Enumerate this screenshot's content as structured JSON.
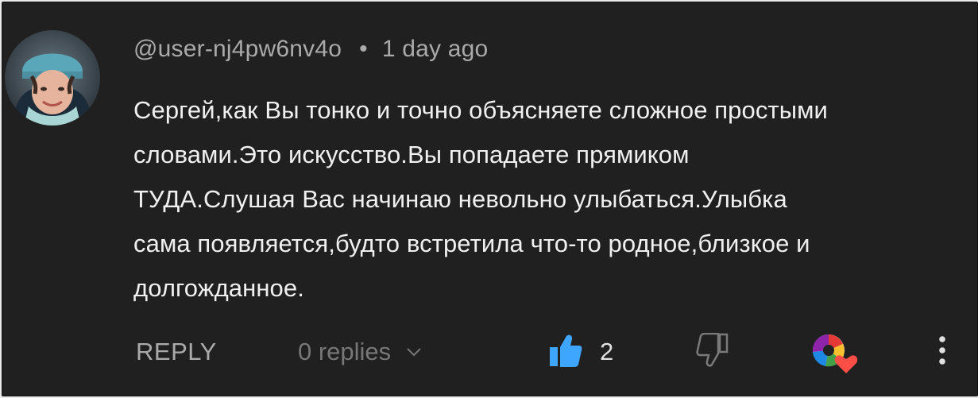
{
  "comment": {
    "author": "@user-nj4pw6nv4o",
    "separator": "•",
    "timestamp": "1 day ago",
    "text_lines": [
      "Сергей,как Вы тонко и точно объясняете сложное простыми",
      "словами.Это искусство.Вы попадаете прямиком",
      "ТУДА.Слушая Вас начинаю невольно улыбаться.Улыбка",
      "сама появляется,будто встретила что-то родное,близкое и",
      "долгожданное."
    ]
  },
  "actions": {
    "reply_label": "REPLY",
    "replies_label": "0 replies",
    "like_count": "2"
  },
  "icons": {
    "like": "thumbs-up-icon",
    "dislike": "thumbs-down-icon",
    "creator_heart": "creator-heart-icon",
    "more": "more-vertical-icon",
    "replies_toggle": "chevron-down-icon"
  },
  "colors": {
    "background": "#202020",
    "text_primary": "#f0f0f0",
    "text_secondary": "#aaaaaa",
    "like_active": "#3ea6ff",
    "heart": "#ff4e45"
  }
}
